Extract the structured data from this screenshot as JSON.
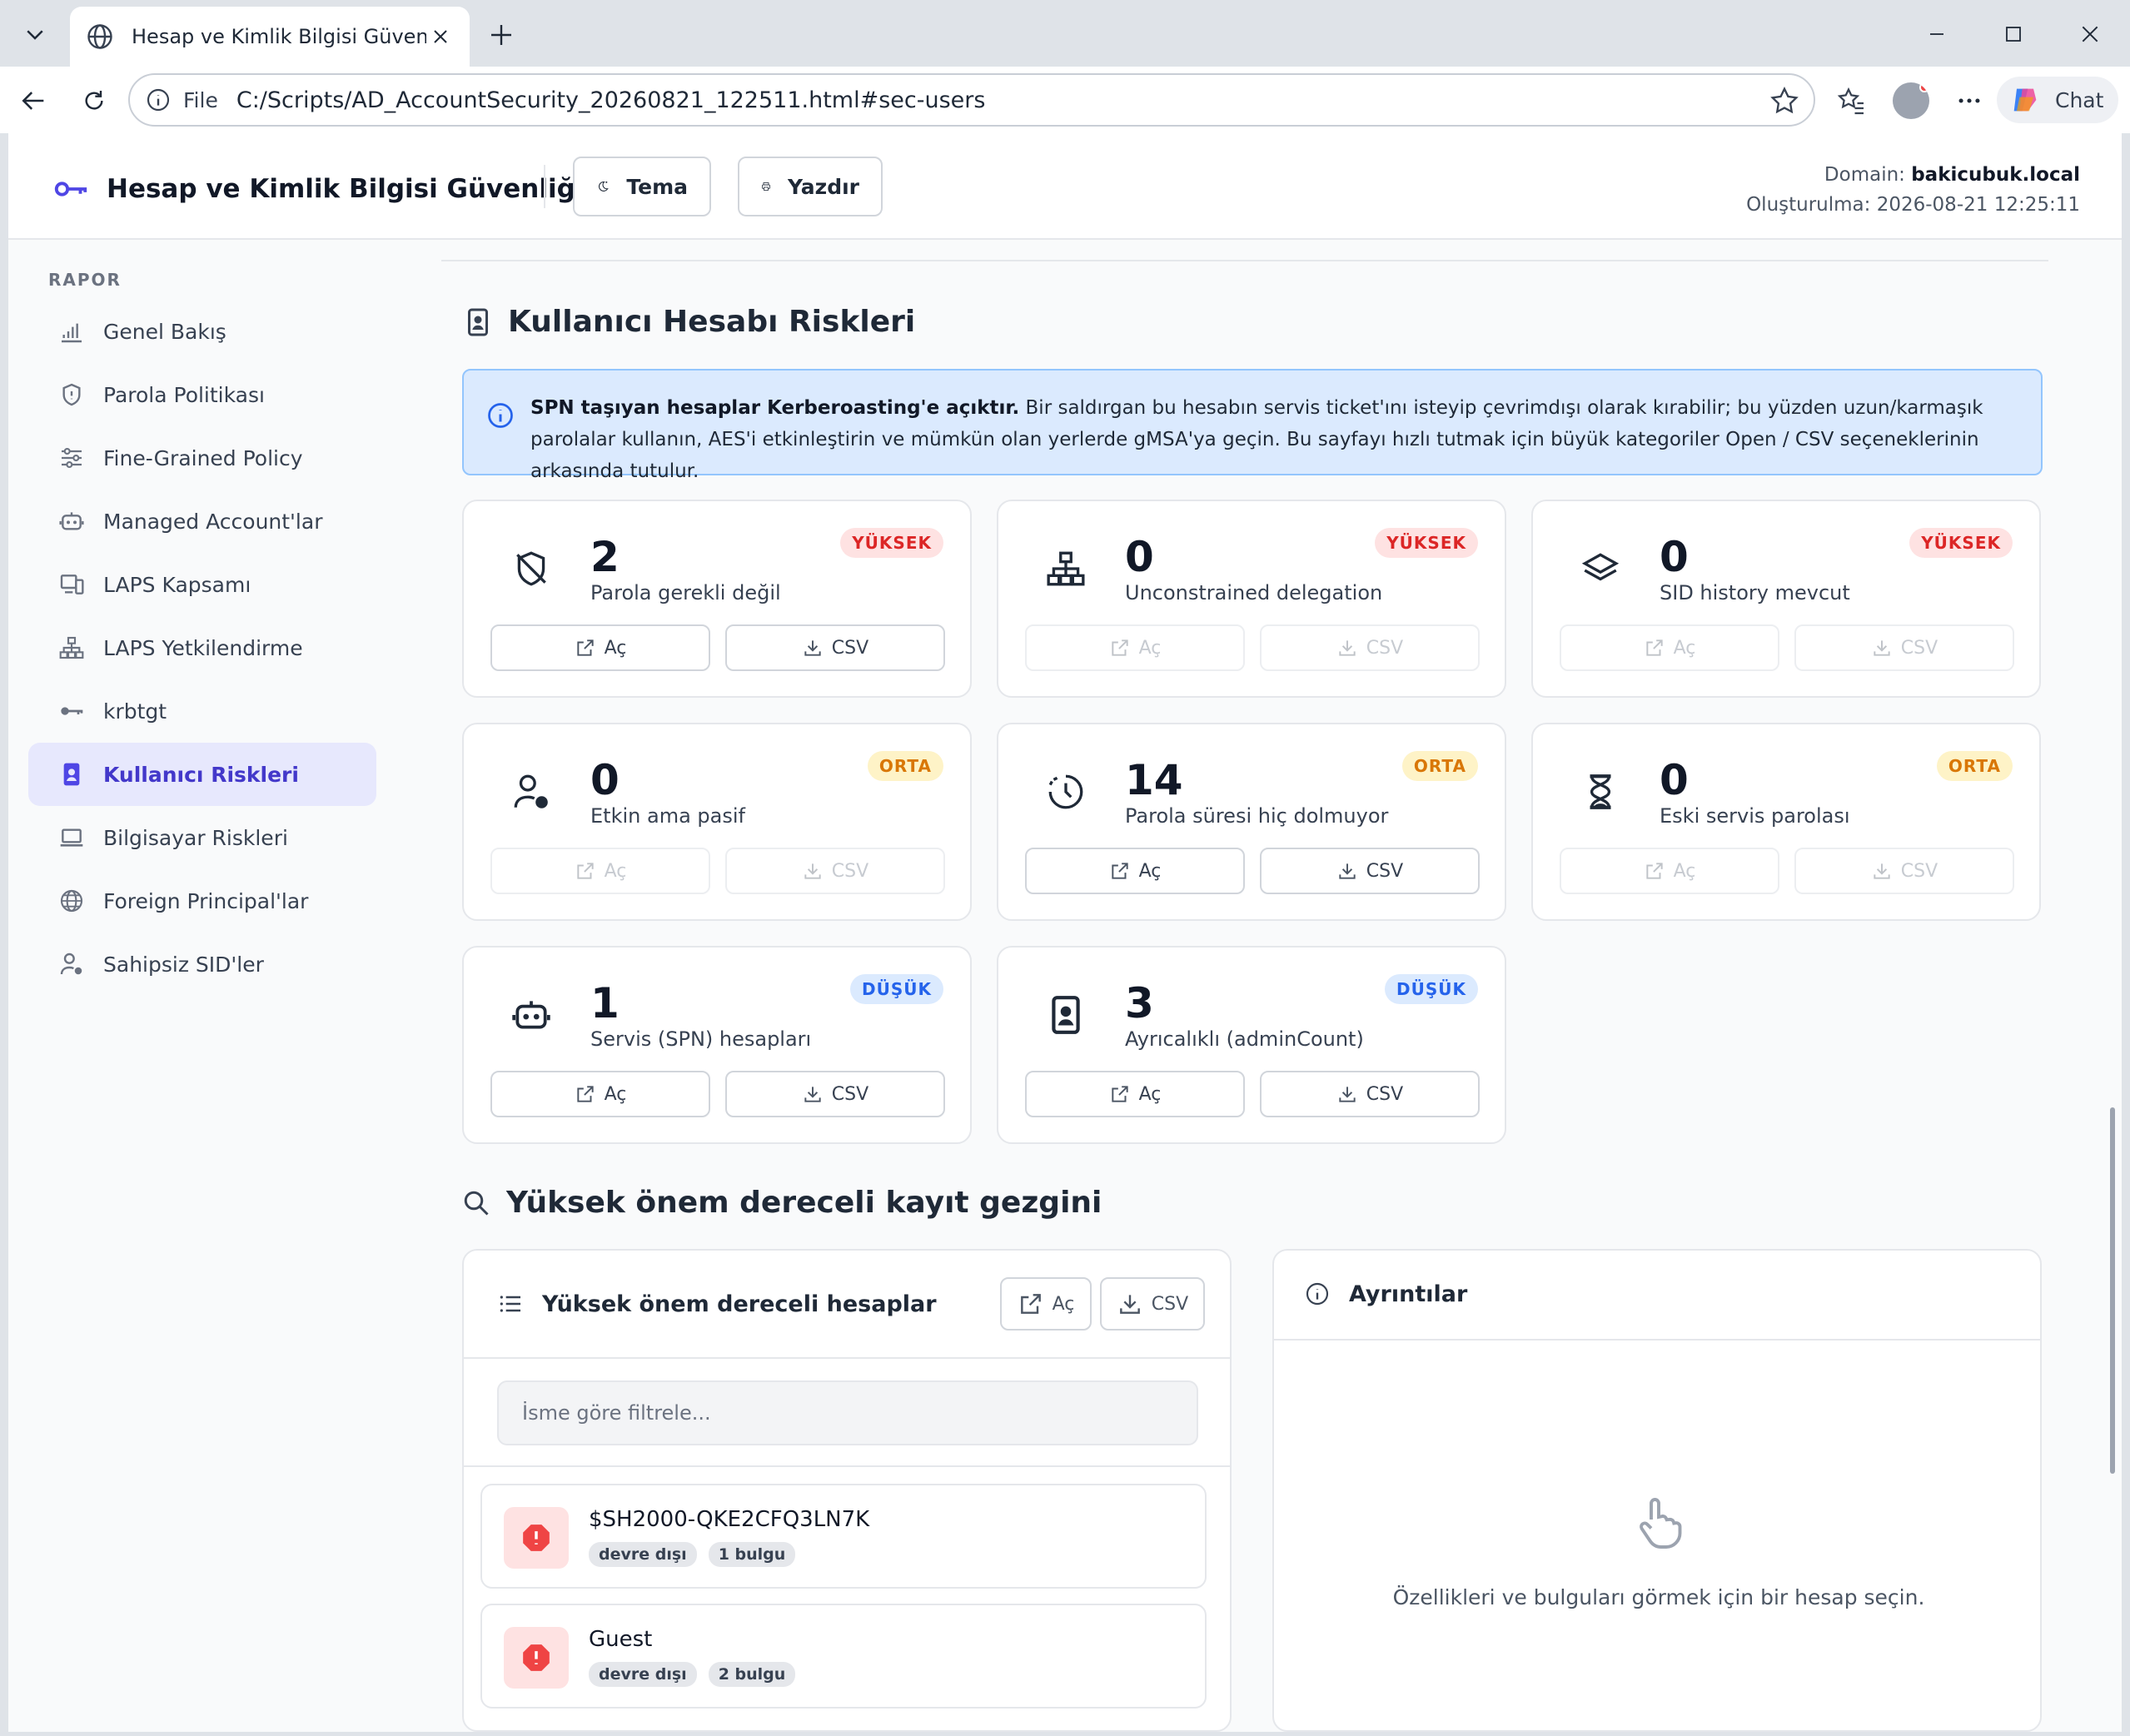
{
  "browser": {
    "tab_title": "Hesap ve Kimlik Bilgisi Güvenliği –",
    "address_scheme": "File",
    "url": "C:/Scripts/AD_AccountSecurity_20260821_122511.html#sec-users",
    "chat_label": "Chat"
  },
  "header": {
    "title": "Hesap ve Kimlik Bilgisi Güvenliği",
    "theme_label": "Tema",
    "print_label": "Yazdır",
    "domain_label": "Domain:",
    "domain_value": "bakicubuk.local",
    "created_label": "Oluşturulma:",
    "created_value": "2026-08-21 12:25:11"
  },
  "sidebar": {
    "heading": "RAPOR",
    "items": [
      {
        "label": "Genel Bakış",
        "icon": "bar-chart-icon"
      },
      {
        "label": "Parola Politikası",
        "icon": "shield-icon"
      },
      {
        "label": "Fine-Grained Policy",
        "icon": "sliders-icon"
      },
      {
        "label": "Managed Account'lar",
        "icon": "robot-icon"
      },
      {
        "label": "LAPS Kapsamı",
        "icon": "devices-icon"
      },
      {
        "label": "LAPS Yetkilendirme",
        "icon": "hierarchy-icon"
      },
      {
        "label": "krbtgt",
        "icon": "key-icon"
      },
      {
        "label": "Kullanıcı Riskleri",
        "icon": "id-badge-icon",
        "active": true
      },
      {
        "label": "Bilgisayar Riskleri",
        "icon": "laptop-icon"
      },
      {
        "label": "Foreign Principal'lar",
        "icon": "globe-icon"
      },
      {
        "label": "Sahipsiz SID'ler",
        "icon": "person-gear-icon"
      }
    ]
  },
  "main": {
    "section_title": "Kullanıcı Hesabı Riskleri",
    "alert_bold": "SPN taşıyan hesaplar Kerberoasting'e açıktır.",
    "alert_text": " Bir saldırgan bu hesabın servis ticket'ını isteyip çevrimdışı olarak kırabilir; bu yüzden uzun/karmaşık parolalar kullanın, AES'i etkinleştirin ve mümkün olan yerlerde gMSA'ya geçin. Bu sayfayı hızlı tutmak için büyük kategoriler Open / CSV seçeneklerinin arkasında tutulur.",
    "open_label": "Aç",
    "csv_label": "CSV",
    "cards": [
      {
        "value": "2",
        "label": "Parola gerekli değil",
        "severity": "YÜKSEK",
        "level": "high",
        "icon": "shield-slash-icon"
      },
      {
        "value": "0",
        "label": "Unconstrained delegation",
        "severity": "YÜKSEK",
        "level": "high",
        "icon": "network-icon"
      },
      {
        "value": "0",
        "label": "SID history mevcut",
        "severity": "YÜKSEK",
        "level": "high",
        "icon": "layers-icon"
      },
      {
        "value": "0",
        "label": "Etkin ama pasif",
        "severity": "ORTA",
        "level": "mid",
        "icon": "person-dot-icon"
      },
      {
        "value": "14",
        "label": "Parola süresi hiç dolmuyor",
        "severity": "ORTA",
        "level": "mid",
        "icon": "clock-icon"
      },
      {
        "value": "0",
        "label": "Eski servis parolası",
        "severity": "ORTA",
        "level": "mid",
        "icon": "hourglass-icon"
      },
      {
        "value": "1",
        "label": "Servis (SPN) hesapları",
        "severity": "DÜŞÜK",
        "level": "low",
        "icon": "robot-icon"
      },
      {
        "value": "3",
        "label": "Ayrıcalıklı (adminCount)",
        "severity": "DÜŞÜK",
        "level": "low",
        "icon": "id-badge-icon"
      }
    ],
    "explorer_title": "Yüksek önem dereceli kayıt gezgini",
    "list_title": "Yüksek önem dereceli hesaplar",
    "filter_placeholder": "İsme göre filtrele...",
    "rows": [
      {
        "name": "$SH2000-QKE2CFQ3LN7K",
        "tags": [
          "devre dışı",
          "1 bulgu"
        ]
      },
      {
        "name": "Guest",
        "tags": [
          "devre dışı",
          "2 bulgu"
        ]
      }
    ],
    "details_title": "Ayrıntılar",
    "details_empty": "Özellikleri ve bulguları görmek için bir hesap seçin."
  }
}
